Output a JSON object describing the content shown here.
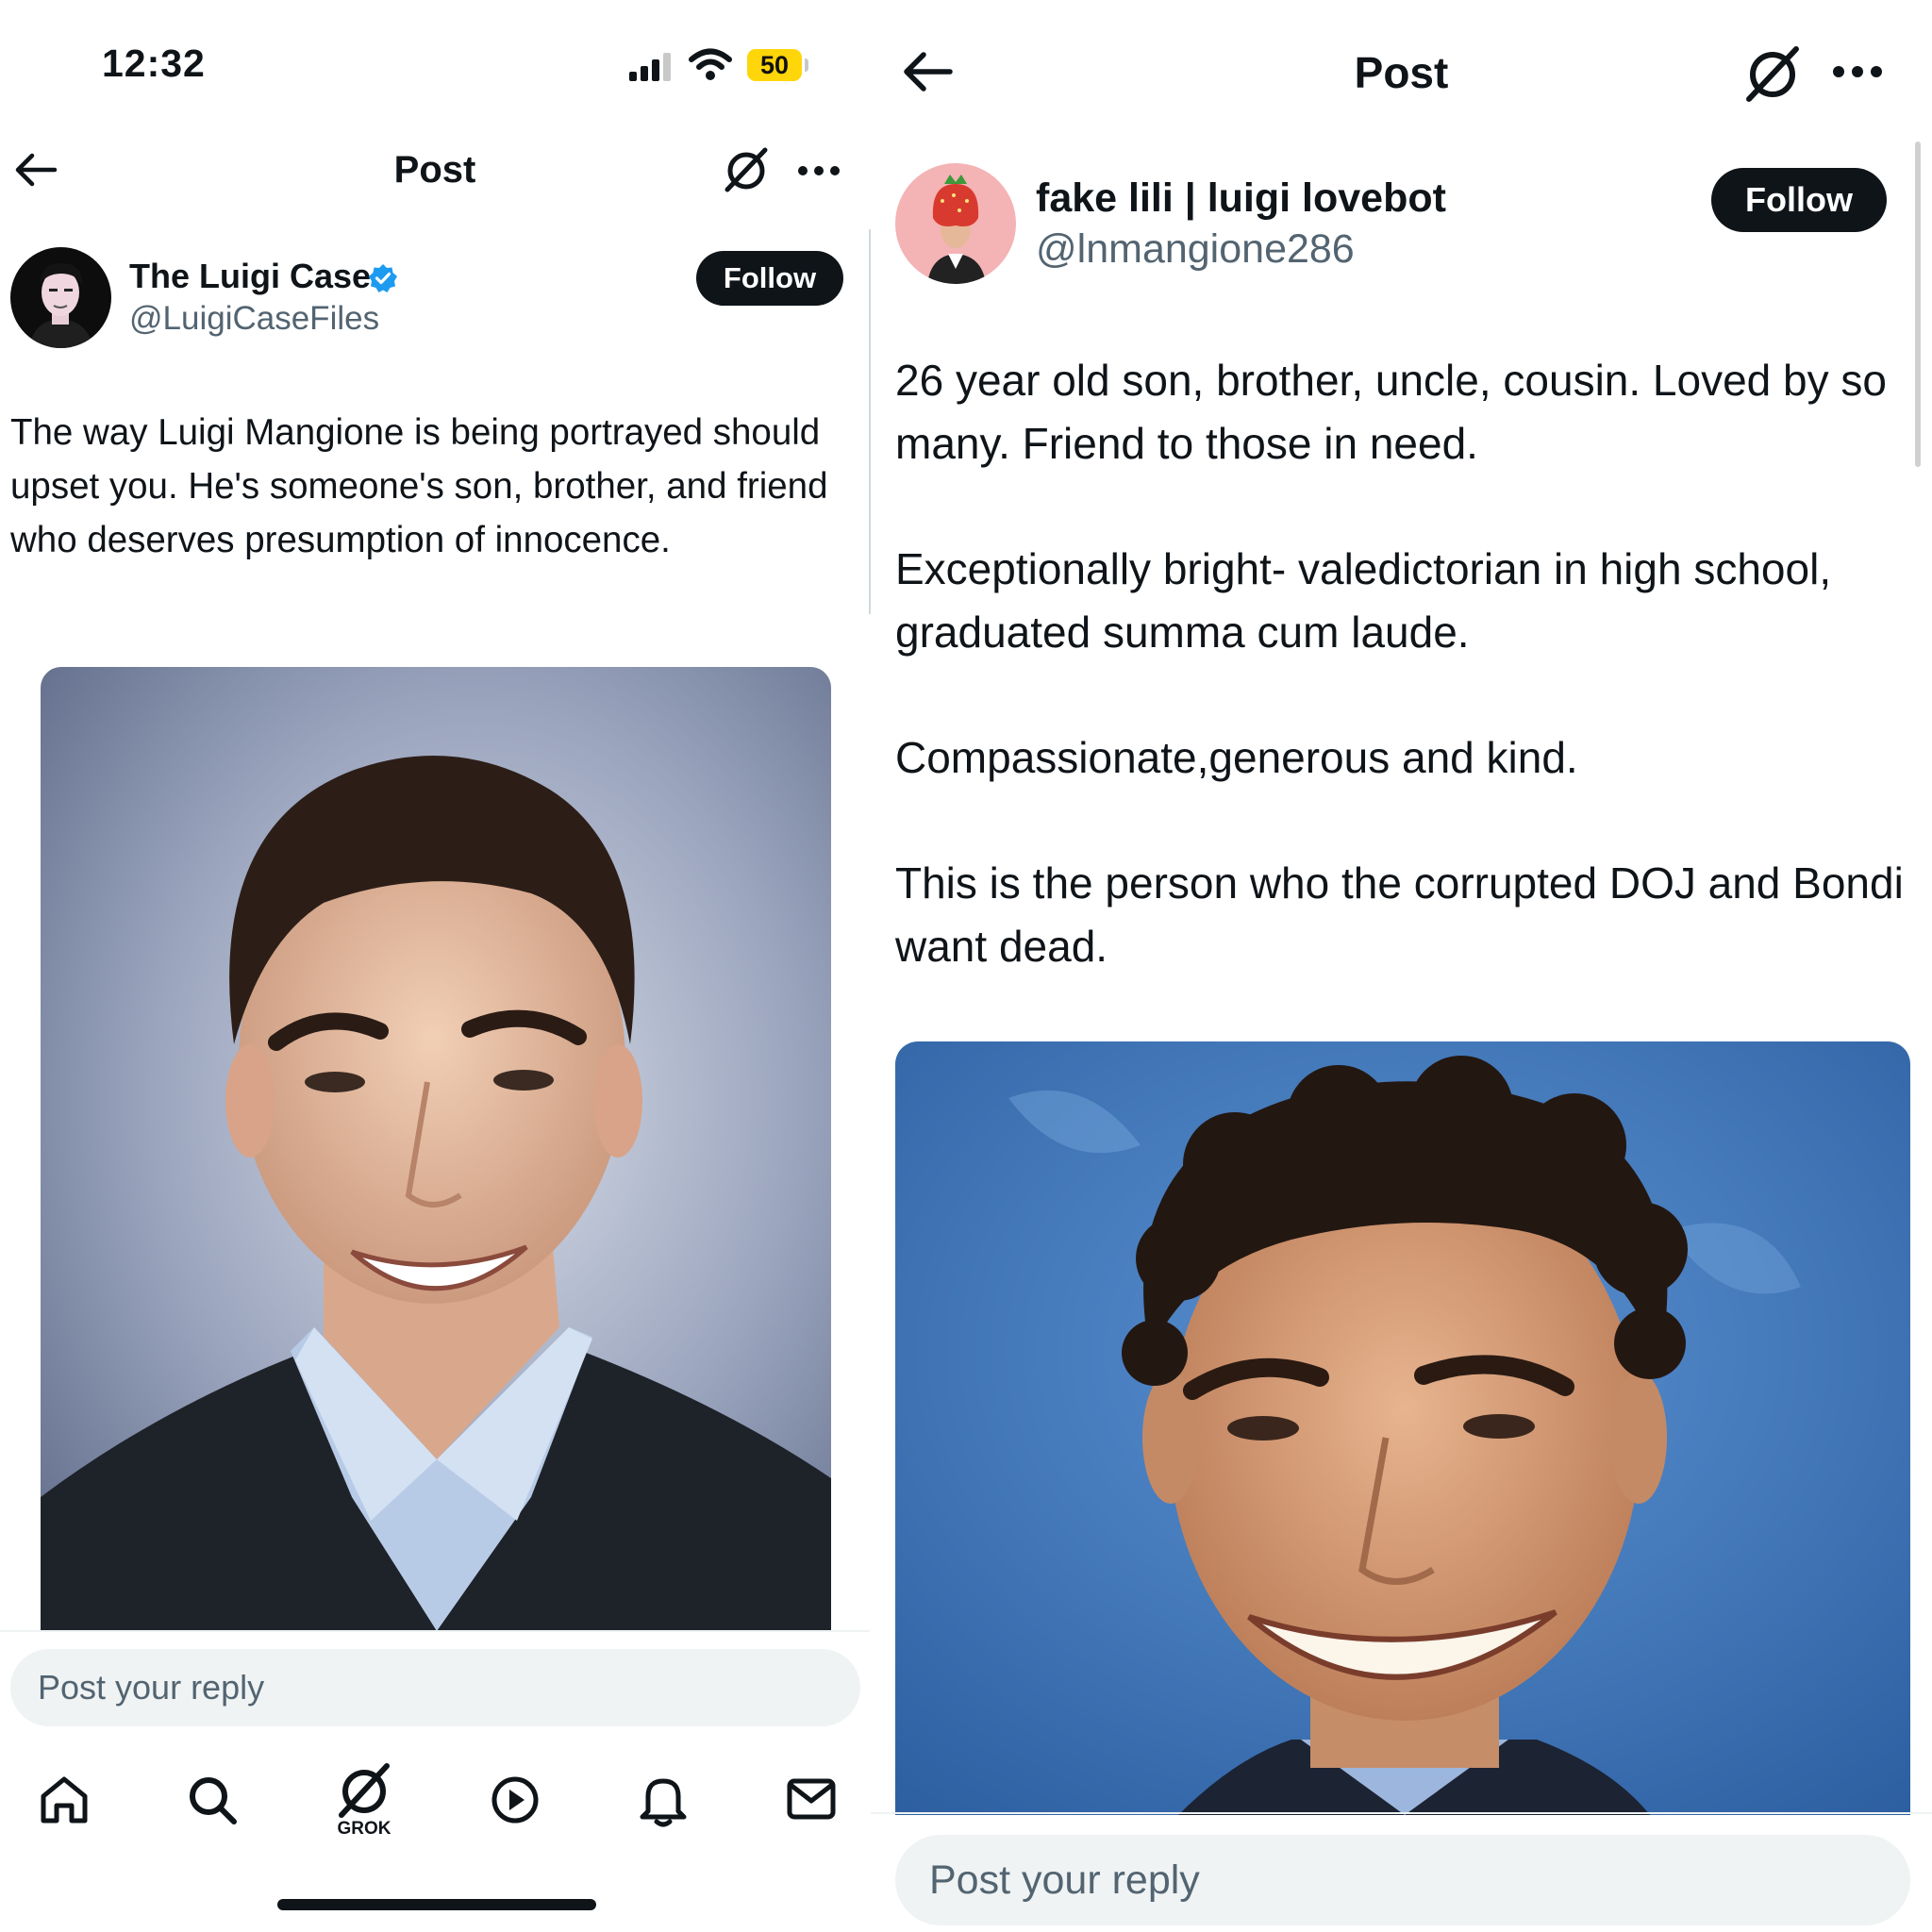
{
  "left": {
    "status_bar": {
      "time": "12:32",
      "battery": "50"
    },
    "header": {
      "title": "Post"
    },
    "author": {
      "name": "The Luigi Case",
      "handle": "@LuigiCaseFiles",
      "verified": true
    },
    "follow_label": "Follow",
    "post_text": "The way Luigi Mangione is being portrayed should upset you. He's someone's son, brother, and friend who deserves presumption of innocence.",
    "reply_placeholder": "Post your reply",
    "tab_bar": {
      "items": [
        {
          "icon": "home-icon"
        },
        {
          "icon": "search-icon"
        },
        {
          "icon": "grok-icon",
          "label": "GROK"
        },
        {
          "icon": "video-icon"
        },
        {
          "icon": "notifications-icon"
        },
        {
          "icon": "messages-icon"
        }
      ]
    }
  },
  "right": {
    "header": {
      "title": "Post"
    },
    "author": {
      "name": "fake lili | luigi lovebot",
      "handle": "@lnmangione286"
    },
    "follow_label": "Follow",
    "post_paragraphs": [
      "26 year old son, brother, uncle, cousin. Loved by so many. Friend to those in need.",
      "Exceptionally bright- valedictorian in high school, graduated summa cum laude.",
      "Compassionate,generous and kind.",
      "This is the person who the corrupted DOJ and Bondi want dead."
    ],
    "reply_placeholder": "Post your reply"
  },
  "colors": {
    "text_primary": "#0f1419",
    "text_secondary": "#536471",
    "verified_blue": "#1d9bf0",
    "battery_yellow": "#ffd60a",
    "reply_bg": "#eff3f4",
    "follow_bg": "#0f1419"
  }
}
